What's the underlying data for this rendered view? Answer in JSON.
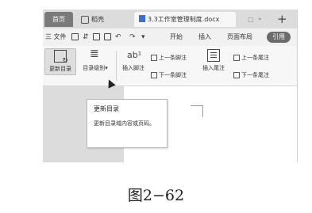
{
  "tabs": {
    "home": "首页",
    "shell": "稻壳",
    "document": "3.3工作室管理制度.docx",
    "add": "+"
  },
  "menu": {
    "file": "三 文件",
    "start": "开始",
    "insert": "插入",
    "layout": "页面布局",
    "reference": "引用"
  },
  "ribbon": {
    "toc": "目录",
    "update_toc": "更新目录",
    "toc_level": "目录级别",
    "insert_footnote": "插入脚注",
    "prev_footnote": "上一条脚注",
    "next_footnote": "下一条脚注",
    "insert_endnote": "插入尾注",
    "prev_endnote": "上一条尾注",
    "next_endnote": "下一条尾注"
  },
  "tooltip": {
    "title": "更新目录",
    "body": "更新目录域内容或页码。"
  },
  "caption": "图2−62",
  "colors": {
    "active_tab": "#7a7a7a",
    "reference_tab": "#6b6b6b",
    "doc_icon": "#3b6fd6"
  }
}
